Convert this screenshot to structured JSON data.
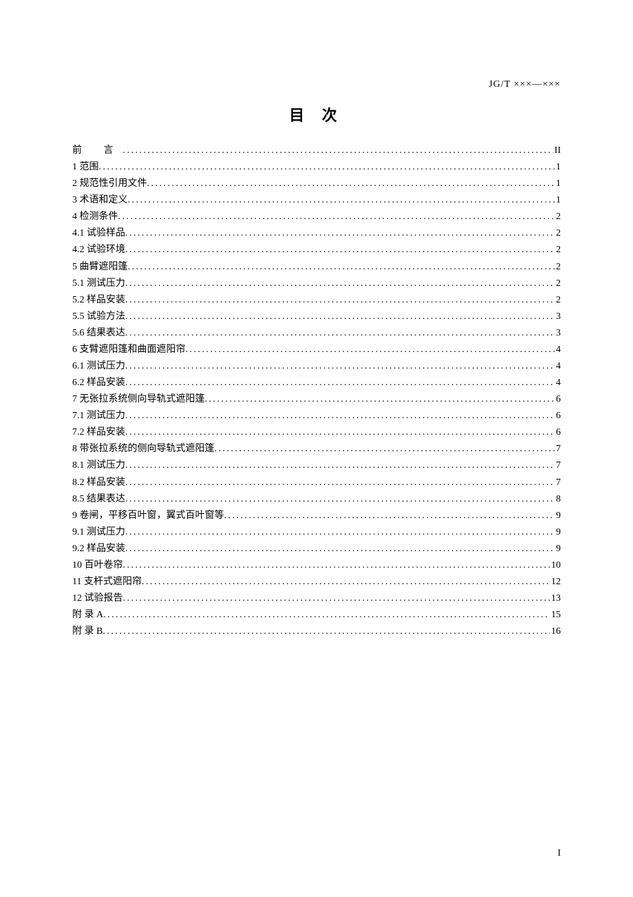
{
  "header_code": "JG/T ×××—×××",
  "title": "目 次",
  "page_number": "I",
  "toc": [
    {
      "label": "前   言",
      "page": "II",
      "preface": true
    },
    {
      "label": "1 范围",
      "page": "1"
    },
    {
      "label": "2 规范性引用文件",
      "page": "1"
    },
    {
      "label": "3 术语和定义",
      "page": "1"
    },
    {
      "label": "4 检测条件",
      "page": "2"
    },
    {
      "label": "4.1 试验样品",
      "page": "2"
    },
    {
      "label": "4.2 试验环境",
      "page": "2"
    },
    {
      "label": "5 曲臂遮阳篷",
      "page": "2"
    },
    {
      "label": "5.1 测试压力",
      "page": "2"
    },
    {
      "label": "5.2 样品安装",
      "page": "2"
    },
    {
      "label": "5.5 试验方法",
      "page": "3"
    },
    {
      "label": "5.6 结果表达",
      "page": "3"
    },
    {
      "label": "6 支臂遮阳篷和曲面遮阳帘",
      "page": "4"
    },
    {
      "label": "6.1 测试压力",
      "page": "4"
    },
    {
      "label": "6.2 样品安装",
      "page": "4"
    },
    {
      "label": "7 无张拉系统侧向导轨式遮阳篷",
      "page": "6"
    },
    {
      "label": "7.1 测试压力",
      "page": "6"
    },
    {
      "label": "7.2 样品安装",
      "page": "6"
    },
    {
      "label": "8 带张拉系统的侧向导轨式遮阳篷",
      "page": "7"
    },
    {
      "label": "8.1 测试压力",
      "page": "7"
    },
    {
      "label": "8.2 样品安装",
      "page": "7"
    },
    {
      "label": "8.5 结果表达",
      "page": "8"
    },
    {
      "label": "9 卷闸，平移百叶窗，翼式百叶窗等",
      "page": "9"
    },
    {
      "label": "9.1 测试压力",
      "page": "9"
    },
    {
      "label": "9.2 样品安装",
      "page": "9"
    },
    {
      "label": "10 百叶卷帘",
      "page": "10"
    },
    {
      "label": "11 支杆式遮阳帘",
      "page": "12"
    },
    {
      "label": "12 试验报告",
      "page": "13"
    },
    {
      "label": "附 录 A",
      "page": "15"
    },
    {
      "label": "附 录 B",
      "page": "16"
    }
  ]
}
